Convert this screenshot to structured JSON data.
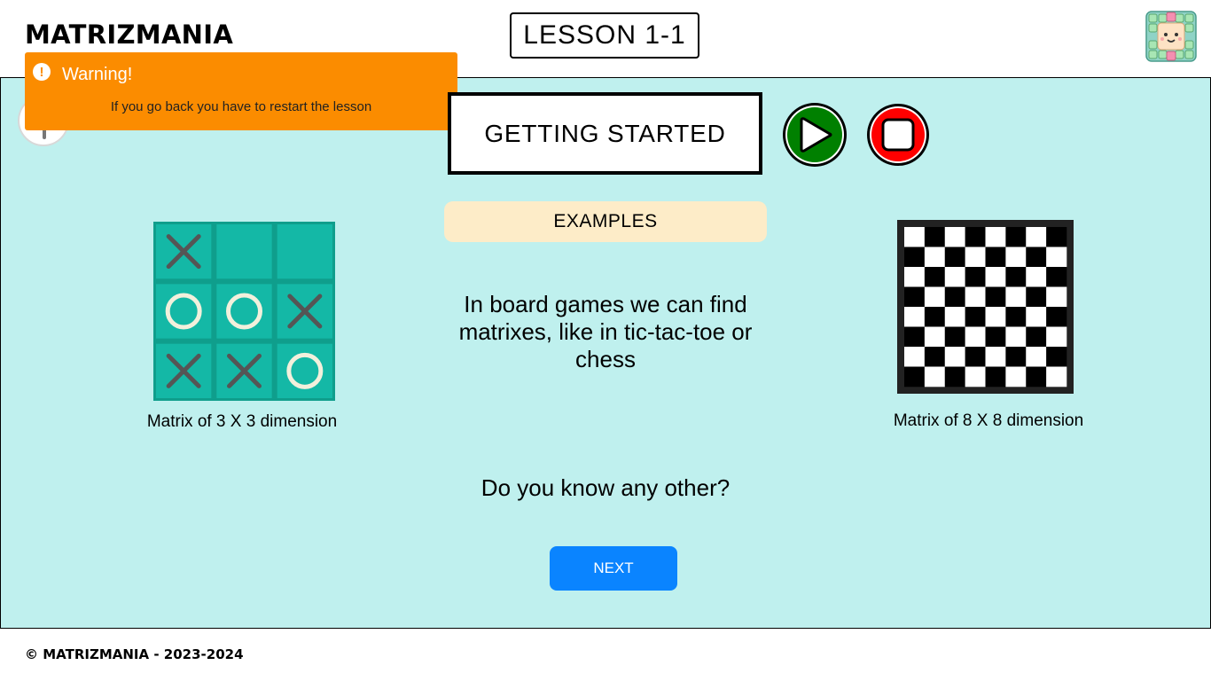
{
  "header": {
    "brand": "MATRIZMANIA",
    "lesson_label": "LESSON 1-1",
    "mascot_icon": "matrix-mascot-icon"
  },
  "toast": {
    "icon": "exclamation-icon",
    "title": "Warning!",
    "message": "If you go back you have to restart the lesson",
    "color": "#fb8c00"
  },
  "lesson": {
    "section_title": "GETTING STARTED",
    "play_icon": "play-icon",
    "stop_icon": "stop-icon",
    "examples_label": "EXAMPLES",
    "left_example": {
      "caption": "Matrix of 3 X 3 dimension",
      "cells": [
        "X",
        "",
        "",
        "O",
        "O",
        "X",
        "X",
        "X",
        "O"
      ]
    },
    "body_text": "In board games we can find matrixes, like in tic-tac-toe or chess",
    "right_example": {
      "caption": "Matrix of 8 X 8 dimension",
      "rows": 8,
      "cols": 8
    },
    "question": "Do you know any other?",
    "next_label": "NEXT"
  },
  "colors": {
    "stage_bg": "#bff0ee",
    "play": "#008000",
    "stop": "#ff0000",
    "next": "#0a84ff",
    "ttt_tile": "#14b8a6",
    "examples_bg": "#fdecc8"
  },
  "footer": {
    "copyright": "© MATRIZMANIA - 2023-2024"
  }
}
